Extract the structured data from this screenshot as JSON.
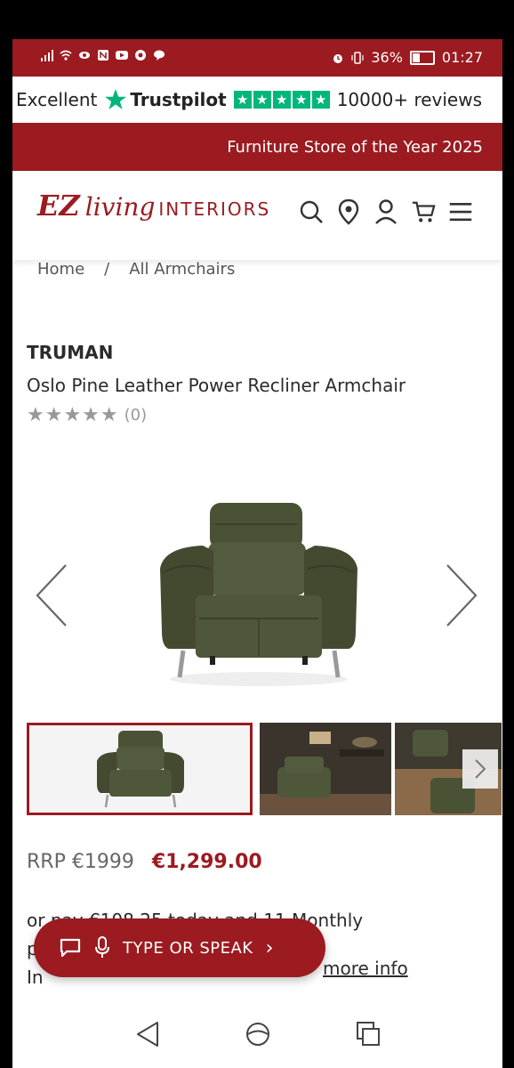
{
  "status_bar": {
    "battery": "36%",
    "time": "01:27"
  },
  "trustpilot": {
    "rating_word": "Excellent",
    "brand": "Trustpilot",
    "reviews": "10000+ reviews"
  },
  "award_banner": "Furniture Store of the Year 2025",
  "logo": {
    "ez": "EZ",
    "living": "living",
    "interiors": "INTERIORS"
  },
  "breadcrumb": {
    "home": "Home",
    "separator": "/",
    "category": "All Armchairs"
  },
  "product": {
    "brand": "TRUMAN",
    "title": "Oslo Pine Leather Power Recliner Armchair",
    "review_count": "(0)",
    "stars": "★★★★★",
    "rrp": "RRP €1999",
    "price": "€1,299.00",
    "finance_line1": "or pay €108.25 today and 11 Monthly",
    "finance_line2_prefix": "p",
    "finance_line3_prefix": "In",
    "more_info": "more info"
  },
  "voice_assistant": {
    "label": "TYPE OR SPEAK",
    "chevron": "›"
  },
  "colors": {
    "brand_red": "#9b1b20",
    "trustpilot_green": "#00b67a",
    "chair_green": "#4a5236"
  }
}
